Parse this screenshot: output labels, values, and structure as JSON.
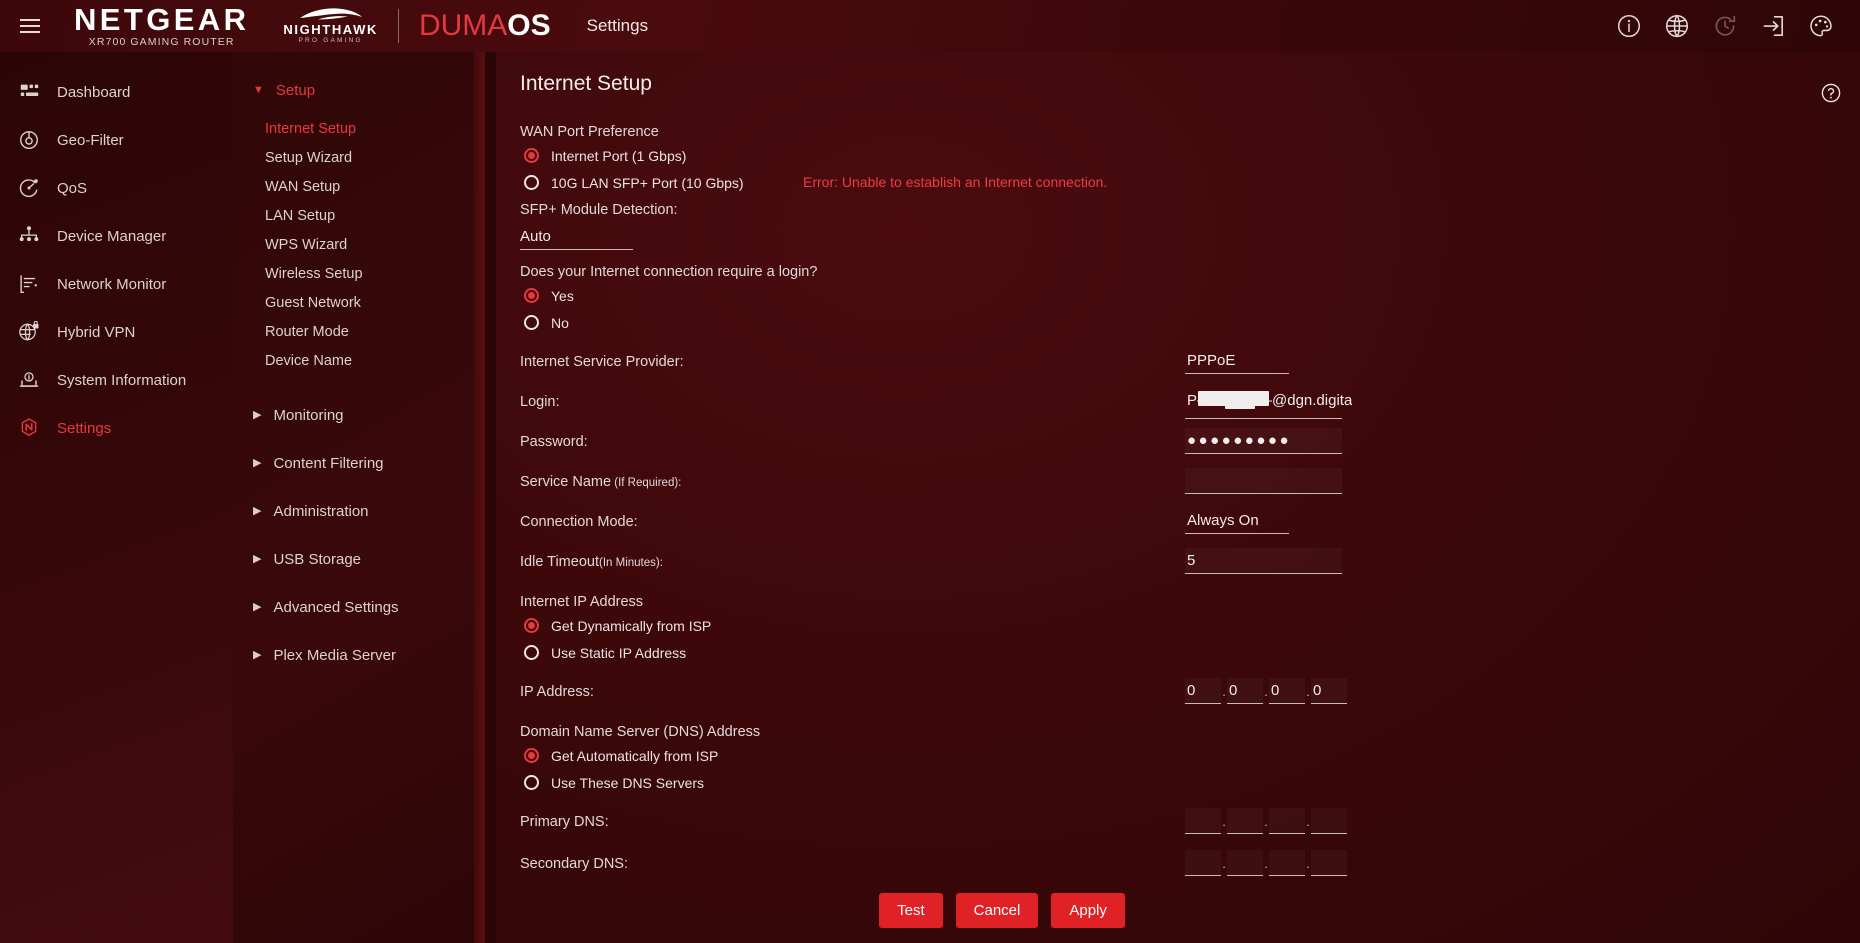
{
  "topbar": {
    "menu_icon": "hamburger-icon",
    "brand_name": "NETGEAR",
    "brand_sub": "XR700 GAMING ROUTER",
    "nighthawk_name": "NIGHTHAWK",
    "nighthawk_sub": "PRO GAMING",
    "os_name_1": "DUMA",
    "os_name_2": "OS",
    "page_title": "Settings",
    "icons": [
      {
        "name": "info-icon",
        "label": "Info"
      },
      {
        "name": "globe-icon",
        "label": "Language"
      },
      {
        "name": "history-refresh-icon",
        "label": "Reboot"
      },
      {
        "name": "logout-icon",
        "label": "Logout"
      },
      {
        "name": "theme-palette-icon",
        "label": "Theme"
      }
    ]
  },
  "sidebar": {
    "items": [
      {
        "label": "Dashboard",
        "icon": "dashboard-icon",
        "active": false
      },
      {
        "label": "Geo-Filter",
        "icon": "geofilter-icon",
        "active": false
      },
      {
        "label": "QoS",
        "icon": "qos-icon",
        "active": false
      },
      {
        "label": "Device Manager",
        "icon": "device-manager-icon",
        "active": false
      },
      {
        "label": "Network Monitor",
        "icon": "network-monitor-icon",
        "active": false
      },
      {
        "label": "Hybrid VPN",
        "icon": "hybrid-vpn-icon",
        "active": false
      },
      {
        "label": "System Information",
        "icon": "system-information-icon",
        "active": false
      },
      {
        "label": "Settings",
        "icon": "netgear-settings-icon",
        "active": true
      }
    ]
  },
  "subnav": {
    "setup_section": {
      "label": "Setup",
      "expanded": true,
      "items": [
        {
          "label": "Internet Setup",
          "active": true
        },
        {
          "label": "Setup Wizard",
          "active": false
        },
        {
          "label": "WAN Setup",
          "active": false
        },
        {
          "label": "LAN Setup",
          "active": false
        },
        {
          "label": "WPS Wizard",
          "active": false
        },
        {
          "label": "Wireless Setup",
          "active": false
        },
        {
          "label": "Guest Network",
          "active": false
        },
        {
          "label": "Router Mode",
          "active": false
        },
        {
          "label": "Device Name",
          "active": false
        }
      ]
    },
    "collapsed_sections": [
      {
        "label": "Monitoring"
      },
      {
        "label": "Content Filtering"
      },
      {
        "label": "Administration"
      },
      {
        "label": "USB Storage"
      },
      {
        "label": "Advanced Settings"
      },
      {
        "label": "Plex Media Server"
      }
    ]
  },
  "main": {
    "title": "Internet Setup",
    "help_icon": "help-question-icon",
    "wan_port": {
      "group_label": "WAN Port Preference",
      "options": [
        {
          "label": "Internet Port (1 Gbps)",
          "selected": true
        },
        {
          "label": "10G LAN SFP+ Port (10 Gbps)",
          "selected": false
        }
      ],
      "error_message": "Error: Unable to establish an Internet connection."
    },
    "sfp": {
      "label": "SFP+ Module Detection:",
      "value": "Auto"
    },
    "login_question": {
      "label": "Does your Internet connection require a login?",
      "options": [
        {
          "label": "Yes",
          "selected": true
        },
        {
          "label": "No",
          "selected": false
        }
      ]
    },
    "fields": [
      {
        "label": "Internet Service Provider:",
        "value": "PPPoE",
        "type": "select",
        "name": "isp"
      },
      {
        "label": "Login:",
        "value": "P█████@dgn.digita",
        "type": "text-redacted",
        "name": "login"
      },
      {
        "label": "Password:",
        "value": "●●●●●●●●●",
        "type": "password",
        "name": "password"
      },
      {
        "label": "Service Name",
        "label_suffix": " (If Required):",
        "value": "",
        "type": "text",
        "name": "service-name"
      },
      {
        "label": "Connection Mode:",
        "value": "Always On",
        "type": "select",
        "name": "connection-mode"
      },
      {
        "label": "Idle Timeout",
        "label_suffix": "(In Minutes):",
        "value": "5",
        "type": "text",
        "name": "idle-timeout"
      }
    ],
    "internet_ip": {
      "group_label": "Internet IP Address",
      "options": [
        {
          "label": "Get Dynamically from ISP",
          "selected": true
        },
        {
          "label": "Use Static IP Address",
          "selected": false
        }
      ],
      "ip_address": {
        "label": "IP Address:",
        "octets": [
          "0",
          "0",
          "0",
          "0"
        ]
      }
    },
    "dns": {
      "group_label": "Domain Name Server (DNS) Address",
      "options": [
        {
          "label": "Get Automatically from ISP",
          "selected": true
        },
        {
          "label": "Use These DNS Servers",
          "selected": false
        }
      ],
      "primary": {
        "label": "Primary DNS:",
        "octets": [
          "",
          "",
          "",
          ""
        ]
      },
      "secondary": {
        "label": "Secondary DNS:",
        "octets": [
          "",
          "",
          "",
          ""
        ]
      }
    },
    "buttons": [
      {
        "label": "Test",
        "name": "test-button"
      },
      {
        "label": "Cancel",
        "name": "cancel-button"
      },
      {
        "label": "Apply",
        "name": "apply-button"
      }
    ]
  },
  "colors": {
    "accent_red": "#e8383d",
    "button_red": "#e02126",
    "error_red": "#ef3c41",
    "text": "#e8dede",
    "bg_dark": "#2e0607"
  }
}
